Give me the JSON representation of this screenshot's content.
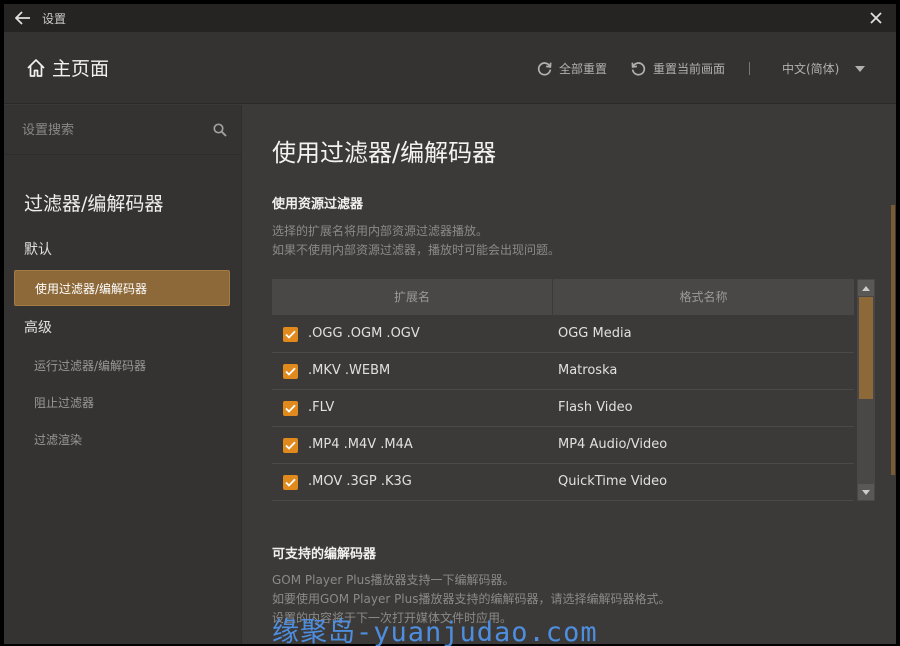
{
  "titlebar": {
    "title": "设置"
  },
  "header": {
    "home_label": "主页面",
    "reset_all": "全部重置",
    "reset_current": "重置当前画面",
    "separator": "|",
    "language": "中文(简体)"
  },
  "sidebar": {
    "search_placeholder": "设置搜索",
    "section_title": "过滤器/编解码器",
    "group_default": "默认",
    "group_advanced": "高级",
    "items": [
      {
        "label": "使用过滤器/编解码器",
        "active": true
      },
      {
        "label": "运行过滤器/编解码器",
        "active": false
      },
      {
        "label": "阻止过滤器",
        "active": false
      },
      {
        "label": "过滤渲染",
        "active": false
      }
    ]
  },
  "main": {
    "page_title": "使用过滤器/编解码器",
    "source_filter": {
      "title": "使用资源过滤器",
      "desc_line1": "选择的扩展名将用内部资源过滤器播放。",
      "desc_line2": "如果不使用内部资源过滤器，播放时可能会出现问题。"
    },
    "table": {
      "col_ext": "扩展名",
      "col_format": "格式名称",
      "rows": [
        {
          "ext": ".OGG .OGM .OGV",
          "format": "OGG Media",
          "checked": true
        },
        {
          "ext": ".MKV .WEBM",
          "format": "Matroska",
          "checked": true
        },
        {
          "ext": ".FLV",
          "format": "Flash Video",
          "checked": true
        },
        {
          "ext": ".MP4 .M4V .M4A",
          "format": "MP4 Audio/Video",
          "checked": true
        },
        {
          "ext": ".MOV .3GP .K3G",
          "format": "QuickTime Video",
          "checked": true
        }
      ]
    },
    "codecs": {
      "title": "可支持的编解码器",
      "desc_line1": "GOM Player Plus播放器支持一下编解码器。",
      "desc_line2": "如要使用GOM Player Plus播放器支持的编解码器，请选择编解码器格式。",
      "desc_line3": "设置的内容将于下一次打开媒体文件时应用。"
    }
  },
  "watermark": "缘聚岛-yuanjudao.com",
  "colors": {
    "accent": "#8d6838",
    "checkbox": "#e08a1e",
    "background": "#3c3a38"
  }
}
